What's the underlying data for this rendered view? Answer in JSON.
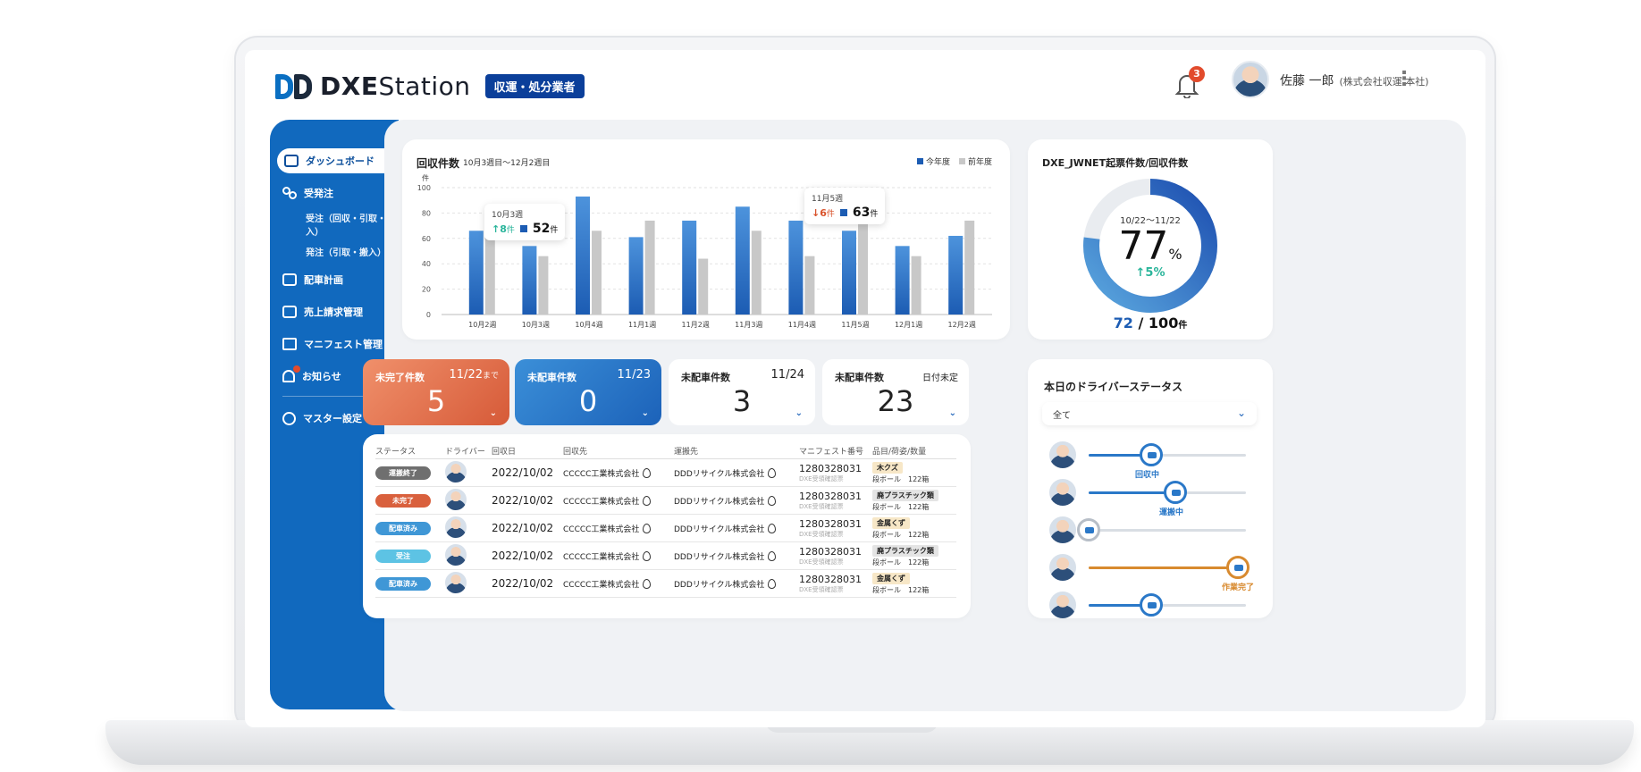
{
  "header": {
    "logo_bold": "DXE",
    "logo_light": "Station",
    "role_badge": "収運・処分業者",
    "notification_count": "3",
    "user_name": "佐藤 一郎",
    "user_org": "(株式会社収運 本社)"
  },
  "sidebar": {
    "items": [
      {
        "label": "ダッシュボード",
        "icon": "dashboard-icon"
      },
      {
        "label": "受発注",
        "icon": "flow-icon"
      },
      {
        "label": "配車計画",
        "icon": "truck-icon"
      },
      {
        "label": "売上請求管理",
        "icon": "invoice-icon"
      },
      {
        "label": "マニフェスト管理",
        "icon": "book-icon"
      },
      {
        "label": "お知らせ",
        "icon": "bell-icon"
      },
      {
        "label": "マスター設定",
        "icon": "gear-icon"
      }
    ],
    "sub_items": [
      "受注（回収・引取・搬入）",
      "発注（引取・搬入）"
    ]
  },
  "chart": {
    "title": "回収件数",
    "subtitle": "10月3週目〜12月2週目",
    "tooltips": [
      {
        "week": "10月3週",
        "delta": "↑8",
        "delta_unit": "件",
        "count": "52",
        "unit": "件"
      },
      {
        "week": "11月5週",
        "delta": "↓6",
        "delta_unit": "件",
        "count": "63",
        "unit": "件"
      }
    ]
  },
  "chart_data": {
    "type": "bar",
    "ylabel": "件",
    "ylim": [
      0,
      100
    ],
    "yticks": [
      0,
      20,
      40,
      60,
      80,
      100
    ],
    "categories": [
      "10月2週",
      "10月3週",
      "10月4週",
      "11月1週",
      "11月2週",
      "11月3週",
      "11月4週",
      "11月5週",
      "12月1週",
      "12月2週"
    ],
    "series": [
      {
        "name": "今年度",
        "color": "#1c5cb3",
        "values": [
          66,
          54,
          93,
          61,
          74,
          85,
          74,
          66,
          54,
          62
        ]
      },
      {
        "name": "前年度",
        "color": "#c8c8c8",
        "values": [
          64,
          46,
          66,
          74,
          44,
          66,
          46,
          74,
          46,
          74
        ]
      }
    ]
  },
  "donut": {
    "title": "DXE_JWNET起票件数/回収件数",
    "range": "10/22〜11/22",
    "percent": "77",
    "percent_unit": "%",
    "change": "↑5%",
    "done": "72",
    "total": "100",
    "total_unit": "件",
    "fraction": 0.77
  },
  "kpis": [
    {
      "label": "未完了件数",
      "date": "11/22",
      "date_suffix": "まで",
      "value": "5",
      "chevron": "⌄"
    },
    {
      "label": "未配車件数",
      "date": "11/23",
      "date_suffix": "",
      "value": "0",
      "chevron": "⌄"
    },
    {
      "label": "未配車件数",
      "date": "11/24",
      "date_suffix": "",
      "value": "3",
      "chevron": "⌄"
    },
    {
      "label": "未配車件数",
      "date": "日付未定",
      "date_suffix": "",
      "value": "23",
      "chevron": "⌄"
    }
  ],
  "table": {
    "headers": [
      "ステータス",
      "ドライバー",
      "回収日",
      "回収先",
      "運搬先",
      "マニフェスト番号",
      "品目/荷姿/数量"
    ],
    "rows": [
      {
        "status": "運搬終了",
        "status_color": "#6f6f6f",
        "date": "2022/10/02",
        "from": "CCCCC工業株式会社",
        "to": "DDDリサイクル株式会社",
        "manifest": "1280328031",
        "manifest_sub": "DXE受領確認票",
        "item": "木クズ",
        "item_color": "#f7e7c7",
        "item_sub": "段ボール　122箱"
      },
      {
        "status": "未完了",
        "status_color": "#d9603d",
        "date": "2022/10/02",
        "from": "CCCCC工業株式会社",
        "to": "DDDリサイクル株式会社",
        "manifest": "1280328031",
        "manifest_sub": "DXE受領確認票",
        "item": "廃プラスチック類",
        "item_color": "#e4e4e4",
        "item_sub": "段ボール　122箱"
      },
      {
        "status": "配車済み",
        "status_color": "#3f97d6",
        "date": "2022/10/02",
        "from": "CCCCC工業株式会社",
        "to": "DDDリサイクル株式会社",
        "manifest": "1280328031",
        "manifest_sub": "DXE受領確認票",
        "item": "金属くず",
        "item_color": "#f7e7c7",
        "item_sub": "段ボール　122箱"
      },
      {
        "status": "受注",
        "status_color": "#5dc3e4",
        "date": "2022/10/02",
        "from": "CCCCC工業株式会社",
        "to": "DDDリサイクル株式会社",
        "manifest": "1280328031",
        "manifest_sub": "DXE受領確認票",
        "item": "廃プラスチック類",
        "item_color": "#e4e4e4",
        "item_sub": "段ボール　122箱"
      },
      {
        "status": "配車済み",
        "status_color": "#3f97d6",
        "date": "2022/10/02",
        "from": "CCCCC工業株式会社",
        "to": "DDDリサイクル株式会社",
        "manifest": "1280328031",
        "manifest_sub": "DXE受領確認票",
        "item": "金属くず",
        "item_color": "#f7e7c7",
        "item_sub": "段ボール　122箱"
      }
    ]
  },
  "drivers": {
    "title": "本日のドライバーステータス",
    "filter": "全て",
    "rows": [
      {
        "status": "回収中",
        "progress": 0.4,
        "color": "#2a78c8"
      },
      {
        "status": "運搬中",
        "progress": 0.55,
        "color": "#2a78c8"
      },
      {
        "status": "",
        "progress": 0.0,
        "color": "#b7bec7"
      },
      {
        "status": "作業完了",
        "progress": 0.95,
        "color": "#d88a2f"
      },
      {
        "status": "",
        "progress": 0.4,
        "color": "#2a78c8"
      }
    ]
  }
}
